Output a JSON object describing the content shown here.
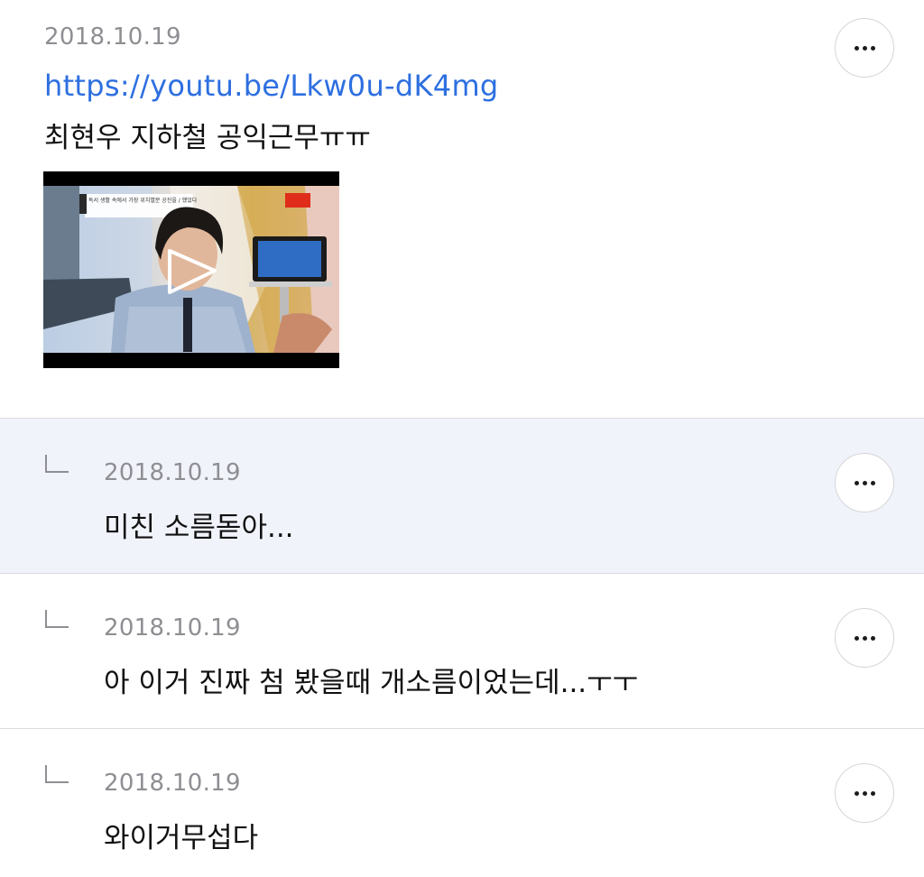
{
  "post": {
    "date": "2018.10.19",
    "link": "https://youtu.be/Lkw0u-dK4mg",
    "text": "최현우 지하철 공익근무ㅠㅠ",
    "video_caption": "독서 생활 속에서 가장 위치별분 공진을 / 했었다"
  },
  "replies": [
    {
      "date": "2018.10.19",
      "text": "미친 소름돋아...",
      "highlighted": true
    },
    {
      "date": "2018.10.19",
      "text": "아 이거 진짜 첨 봤을때 개소름이었는데...ㅜㅜ",
      "highlighted": false
    },
    {
      "date": "2018.10.19",
      "text": "와이거무섭다",
      "highlighted": false
    }
  ],
  "icons": {
    "more": "more-dots-icon",
    "reply": "reply-corner-icon",
    "play": "play-icon"
  },
  "colors": {
    "link": "#2d6fe0",
    "date": "#8e8e93",
    "highlight_bg": "#f1f3fb"
  }
}
